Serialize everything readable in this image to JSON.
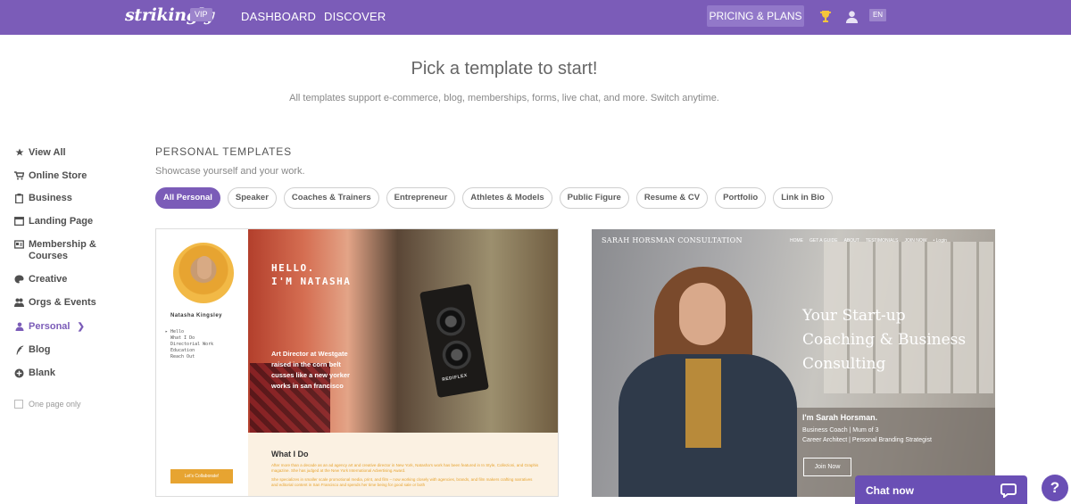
{
  "nav": {
    "logo": "strikingly",
    "badge": "VIP",
    "links": [
      "DASHBOARD",
      "DISCOVER"
    ],
    "pricing": "PRICING & PLANS",
    "lang": "EN",
    "icons": [
      "trophy-icon",
      "user-icon"
    ]
  },
  "header": {
    "title": "Pick a template to start!",
    "subtitle": "All templates support e-commerce, blog, memberships, forms, live chat, and more. Switch anytime."
  },
  "sidebar": {
    "items": [
      {
        "label": "View All",
        "icon": "star-icon"
      },
      {
        "label": "Online Store",
        "icon": "cart-icon"
      },
      {
        "label": "Business",
        "icon": "clipboard-icon"
      },
      {
        "label": "Landing Page",
        "icon": "window-icon"
      },
      {
        "label": "Membership & Courses",
        "icon": "card-icon"
      },
      {
        "label": "Creative",
        "icon": "palette-icon"
      },
      {
        "label": "Orgs & Events",
        "icon": "people-icon"
      },
      {
        "label": "Personal",
        "icon": "person-icon",
        "active": true
      },
      {
        "label": "Blog",
        "icon": "quill-icon"
      },
      {
        "label": "Blank",
        "icon": "plus-circle-icon"
      }
    ],
    "one_page_only": "One page only"
  },
  "section": {
    "title": "PERSONAL TEMPLATES",
    "subtitle": "Showcase yourself and your work.",
    "filters": [
      "All Personal",
      "Speaker",
      "Coaches & Trainers",
      "Entrepreneur",
      "Athletes & Models",
      "Public Figure",
      "Resume & CV",
      "Portfolio",
      "Link in Bio"
    ],
    "active_filter": "All Personal"
  },
  "template1": {
    "name": "Natasha Kingsley",
    "menu": [
      "▸ Hello",
      "What I Do",
      "Directorial Work",
      "Education",
      "Reach Out"
    ],
    "hello": [
      "HELLO.",
      "I'M NATASHA"
    ],
    "blurb": [
      "Art Director at Westgate",
      "raised in the corn belt",
      "cusses like a new yorker",
      "works in san francisco"
    ],
    "camera_brand": "REDIFLEX",
    "what_i_do": "What I Do",
    "body1": "After more than a decade as an ad agency art and creative director in New York, Natasha's work has been featured in In Style, Collezioni, and Graphis magazine. She has judged at the New York International Advertising Award.",
    "body2": "She specializes in smaller scale promotional media, print, and film – now working closely with agencies, brands, and film makers crafting narratives and editorial content in San Francisco and spends her time being for good sale or both",
    "cta": "Let's Collaborate!"
  },
  "template2": {
    "brand": "SARAH HORSMAN CONSULTATION",
    "nav": [
      "HOME",
      "GET A GUIDE",
      "ABOUT",
      "TESTIMONIALS",
      "JOIN NOW",
      "• Login"
    ],
    "headline": [
      "Your Start-up",
      "Coaching & Business",
      "Consulting"
    ],
    "intro": "I'm Sarah Horsman.",
    "roles": [
      "Business Coach | Mum of 3",
      "Career Architect | Personal Branding Strategist"
    ],
    "button": "Join Now"
  },
  "chat": {
    "label": "Chat now",
    "help": "?"
  },
  "colors": {
    "brand": "#7b5cb8",
    "chat": "#6a4fb5",
    "accent_orange": "#e7a431"
  }
}
